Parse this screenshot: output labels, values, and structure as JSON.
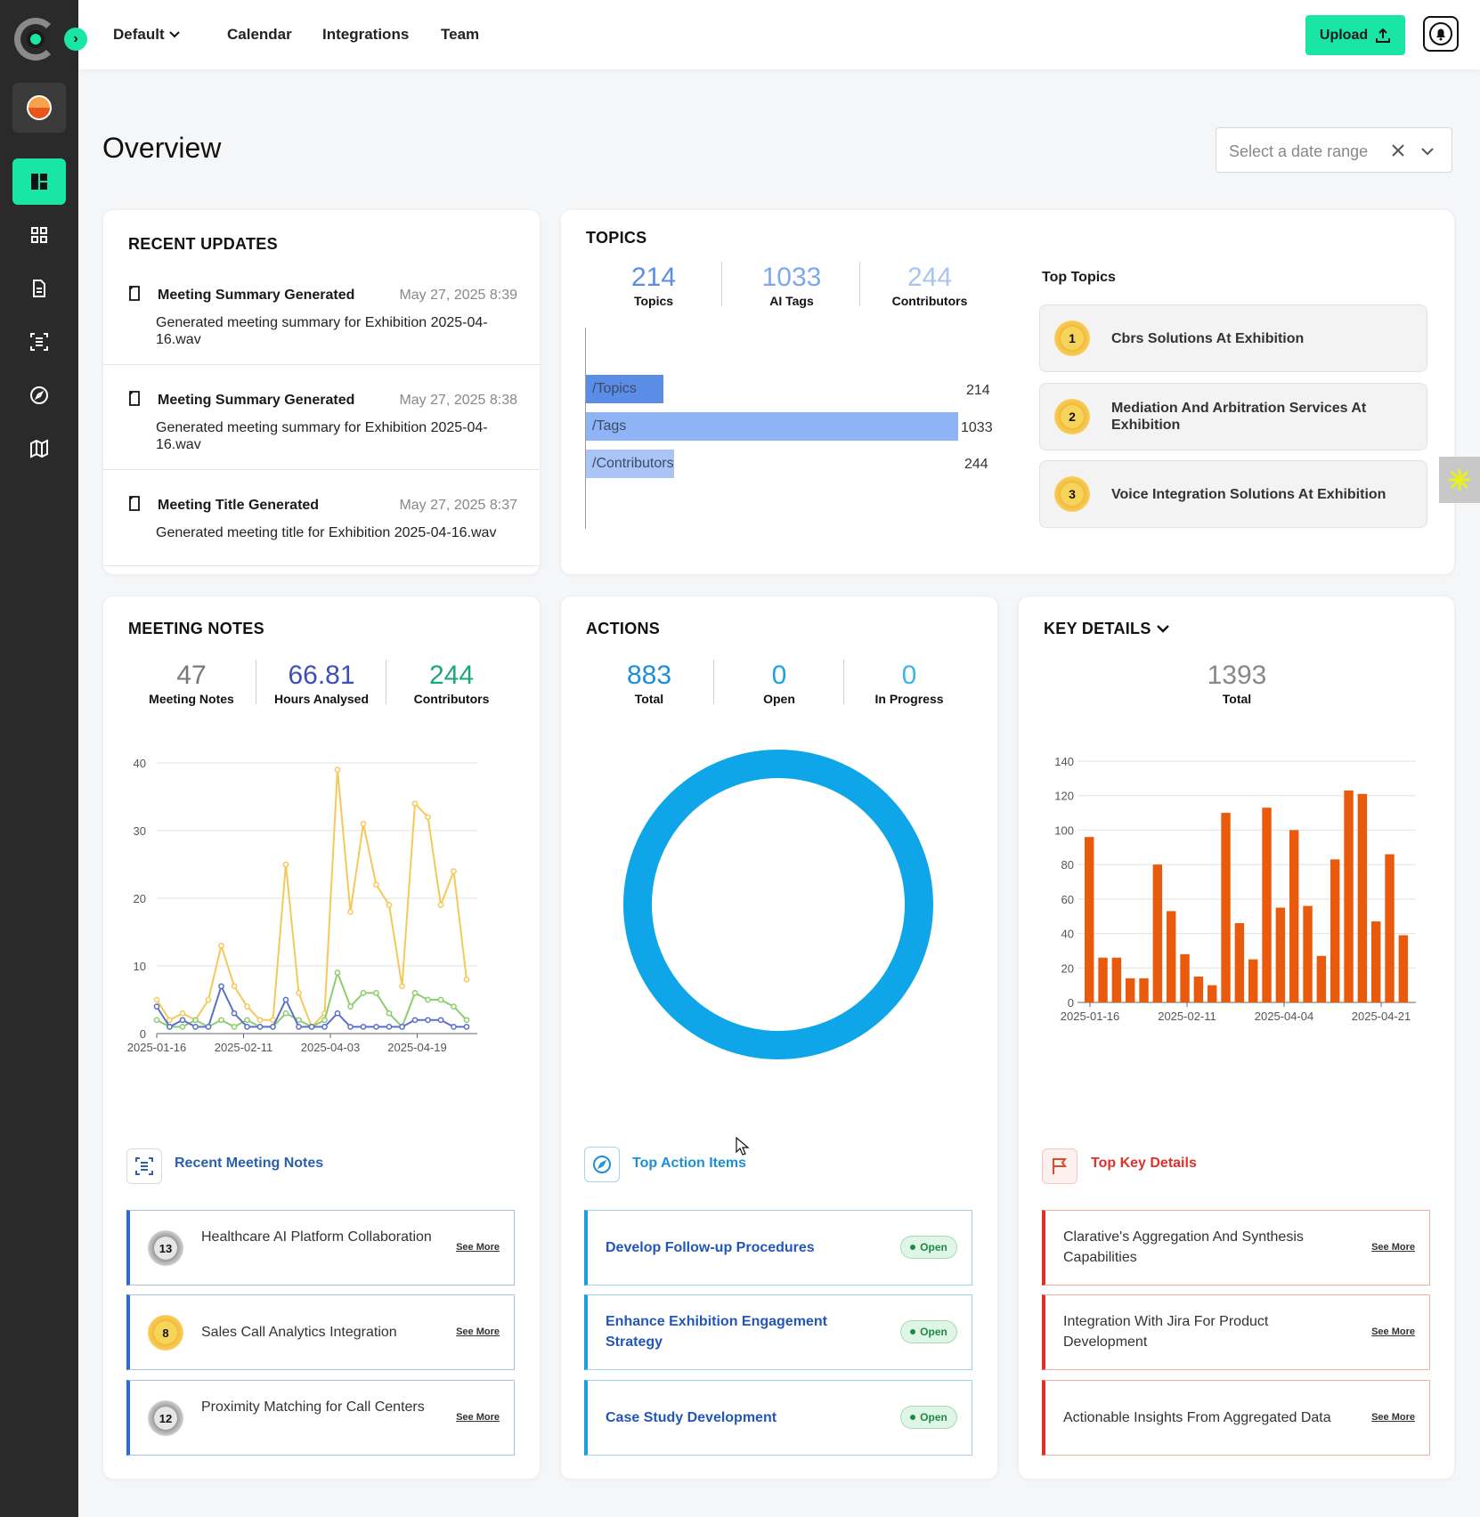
{
  "topbar": {
    "workspace_label": "Default",
    "nav": [
      "Calendar",
      "Integrations",
      "Team"
    ],
    "upload_label": "Upload"
  },
  "page": {
    "title": "Overview",
    "date_placeholder": "Select a date range"
  },
  "recent_updates": {
    "title": "RECENT UPDATES",
    "items": [
      {
        "title": "Meeting Summary Generated",
        "date": "May 27, 2025 8:39",
        "body": "Generated meeting summary for Exhibition 2025-04-16.wav"
      },
      {
        "title": "Meeting Summary Generated",
        "date": "May 27, 2025 8:38",
        "body": "Generated meeting summary for Exhibition 2025-04-16.wav"
      },
      {
        "title": "Meeting Title Generated",
        "date": "May 27, 2025 8:37",
        "body": "Generated meeting title for Exhibition 2025-04-16.wav"
      }
    ]
  },
  "topics": {
    "title": "TOPICS",
    "stats": [
      {
        "value": "214",
        "label": "Topics"
      },
      {
        "value": "1033",
        "label": "AI Tags"
      },
      {
        "value": "244",
        "label": "Contributors"
      }
    ],
    "bars": [
      {
        "label": "/Topics",
        "value": 214
      },
      {
        "label": "/Tags",
        "value": 1033
      },
      {
        "label": "/Contributors",
        "value": 244
      }
    ],
    "bar_values": [
      "214",
      "1033",
      "244"
    ],
    "top_title": "Top Topics",
    "top": [
      {
        "rank": "1",
        "name": "Cbrs Solutions At Exhibition"
      },
      {
        "rank": "2",
        "name": "Mediation And Arbitration Services At Exhibition"
      },
      {
        "rank": "3",
        "name": "Voice Integration Solutions At Exhibition"
      }
    ]
  },
  "meeting_notes": {
    "title": "MEETING NOTES",
    "stats": [
      {
        "value": "47",
        "label": "Meeting Notes"
      },
      {
        "value": "66.81",
        "label": "Hours Analysed"
      },
      {
        "value": "244",
        "label": "Contributors"
      }
    ],
    "section_title": "Recent Meeting Notes",
    "items": [
      {
        "num": "13",
        "title": "Healthcare AI Platform Collaboration"
      },
      {
        "num": "8",
        "title": "Sales Call Analytics Integration"
      },
      {
        "num": "12",
        "title": "Proximity Matching for Call Centers"
      }
    ],
    "see_more": "See More"
  },
  "actions": {
    "title": "ACTIONS",
    "stats": [
      {
        "value": "883",
        "label": "Total"
      },
      {
        "value": "0",
        "label": "Open"
      },
      {
        "value": "0",
        "label": "In Progress"
      }
    ],
    "section_title": "Top Action Items",
    "items": [
      {
        "title": "Develop Follow-up Procedures",
        "status": "Open"
      },
      {
        "title": "Enhance Exhibition Engagement Strategy",
        "status": "Open"
      },
      {
        "title": "Case Study Development",
        "status": "Open"
      }
    ]
  },
  "key_details": {
    "title": "KEY DETAILS",
    "stats": [
      {
        "value": "1393",
        "label": "Total"
      }
    ],
    "section_title": "Top Key Details",
    "items": [
      {
        "title": "Clarative's Aggregation And Synthesis Capabilities"
      },
      {
        "title": "Integration With Jira For Product Development"
      },
      {
        "title": "Actionable Insights From Aggregated Data"
      }
    ],
    "see_more": "See More"
  },
  "chart_data": [
    {
      "type": "line",
      "x_ticks": [
        "2025-01-16",
        "2025-02-11",
        "2025-04-03",
        "2025-04-19"
      ],
      "ylim": [
        0,
        40
      ],
      "y_ticks": [
        0,
        10,
        20,
        30,
        40
      ],
      "series": [
        {
          "color": "#f5c85a",
          "values": [
            5,
            2,
            3,
            2,
            5,
            13,
            7,
            4,
            2,
            2,
            25,
            6,
            1,
            3,
            39,
            18,
            31,
            22,
            19,
            7,
            34,
            32,
            19,
            24,
            8
          ]
        },
        {
          "color": "#8ccd6e",
          "values": [
            2,
            1,
            1,
            2,
            1,
            2,
            1,
            2,
            1,
            1,
            3,
            2,
            1,
            2,
            9,
            4,
            6,
            6,
            3,
            1,
            6,
            5,
            5,
            4,
            2
          ]
        },
        {
          "color": "#5b6fc9",
          "values": [
            4,
            1,
            2,
            1,
            1,
            7,
            3,
            1,
            1,
            1,
            5,
            1,
            1,
            1,
            3,
            1,
            1,
            1,
            1,
            1,
            2,
            2,
            2,
            1,
            1
          ]
        }
      ]
    },
    {
      "type": "pie",
      "values": [
        883
      ],
      "color": "#0ea5e9"
    },
    {
      "type": "bar",
      "x_ticks": [
        "2025-01-16",
        "2025-02-11",
        "2025-04-04",
        "2025-04-21"
      ],
      "ylim": [
        0,
        140
      ],
      "y_ticks": [
        0,
        20,
        40,
        60,
        80,
        100,
        120,
        140
      ],
      "color": "#ea5a0c",
      "values": [
        96,
        26,
        26,
        14,
        14,
        80,
        53,
        28,
        15,
        10,
        110,
        46,
        25,
        113,
        55,
        100,
        56,
        27,
        83,
        123,
        121,
        47,
        86,
        39
      ]
    }
  ]
}
